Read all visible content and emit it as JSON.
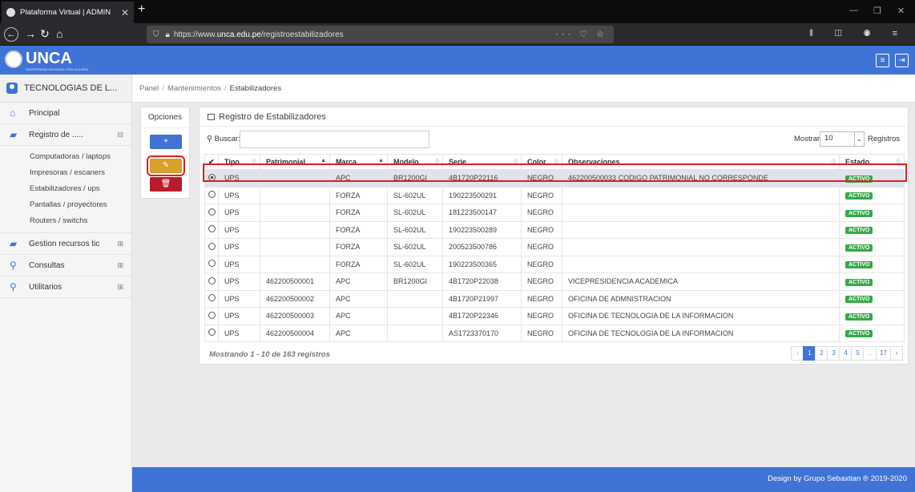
{
  "browser": {
    "tab_title": "Plataforma Virtual | ADMIN",
    "url_prefix": "https://www.",
    "url_host": "unca.edu.pe",
    "url_path": "/registroestabilizadores"
  },
  "header": {
    "logo_text": "UNCA",
    "logo_sub": "UNIVERSIDAD NACIONAL CIRO ALEGRIA",
    "accent": "#3f73d6"
  },
  "sidebar": {
    "user": "TECNOLOGIAS DE L...",
    "items": [
      {
        "label": "Principal",
        "icon": "home-icon"
      },
      {
        "label": "Registro de .....",
        "icon": "book-icon"
      },
      {
        "label": "Gestion recursos tic",
        "icon": "book-icon"
      },
      {
        "label": "Consultas",
        "icon": "search-icon"
      },
      {
        "label": "Utilitarios",
        "icon": "search-users-icon"
      }
    ],
    "subitems": [
      "Computadoras / laptops",
      "Impresoras / escaners",
      "Estabilizadores / ups",
      "Pantallas / proyectores",
      "Routers / switchs"
    ]
  },
  "breadcrumb": [
    "Panel",
    "Mantenimientos",
    "Estabilizadores"
  ],
  "opciones": {
    "title": "Opciones"
  },
  "panel": {
    "title": "Registro de Estabilizadores",
    "search_label": "Buscar:",
    "mostrar_label": "Mostrar",
    "mostrar_value": "10",
    "registros_label": "Registros",
    "showing": "Mostrando 1 - 10 de 163 registros"
  },
  "table": {
    "headers": [
      "Tipo",
      "Patrimonial",
      "Marca",
      "Modelo",
      "Serie",
      "Color",
      "Observaciones",
      "Estado"
    ],
    "rows": [
      [
        "UPS",
        "",
        "APC",
        "BR1200GI",
        "4B1720P22116",
        "NEGRO",
        "462200500033 CODIGO PATRIMONIAL NO CORRESPONDE",
        "ACTIVO"
      ],
      [
        "UPS",
        "",
        "FORZA",
        "SL-602UL",
        "190223500291",
        "NEGRO",
        "",
        "ACTIVO"
      ],
      [
        "UPS",
        "",
        "FORZA",
        "SL-602UL",
        "181223500147",
        "NEGRO",
        "",
        "ACTIVO"
      ],
      [
        "UPS",
        "",
        "FORZA",
        "SL-602UL",
        "190223500289",
        "NEGRO",
        "",
        "ACTIVO"
      ],
      [
        "UPS",
        "",
        "FORZA",
        "SL-602UL",
        "200523500786",
        "NEGRO",
        "",
        "ACTIVO"
      ],
      [
        "UPS",
        "",
        "FORZA",
        "SL-602UL",
        "190223500365",
        "NEGRO",
        "",
        "ACTIVO"
      ],
      [
        "UPS",
        "462200500001",
        "APC",
        "BR1200GI",
        "4B1720P22038",
        "NEGRO",
        "VICEPRESIDENCIA ACADEMICA",
        "ACTIVO"
      ],
      [
        "UPS",
        "462200500002",
        "APC",
        "",
        "4B1720P21997",
        "NEGRO",
        "OFICINA DE ADMNISTRACION",
        "ACTIVO"
      ],
      [
        "UPS",
        "462200500003",
        "APC",
        "",
        "4B1720P22346",
        "NEGRO",
        "OFICINA DE TECNOLOGIA DE LA INFORMACION",
        "ACTIVO"
      ],
      [
        "UPS",
        "462200500004",
        "APC",
        "",
        "AS1723370170",
        "NEGRO",
        "OFICINA DE TECNOLOGIA DE LA INFORMACION",
        "ACTIVO"
      ]
    ]
  },
  "pagination": [
    "1",
    "2",
    "3",
    "4",
    "5",
    "...",
    "17"
  ],
  "footer": "Design by Grupo Sebaxtian ® 2019-2020"
}
